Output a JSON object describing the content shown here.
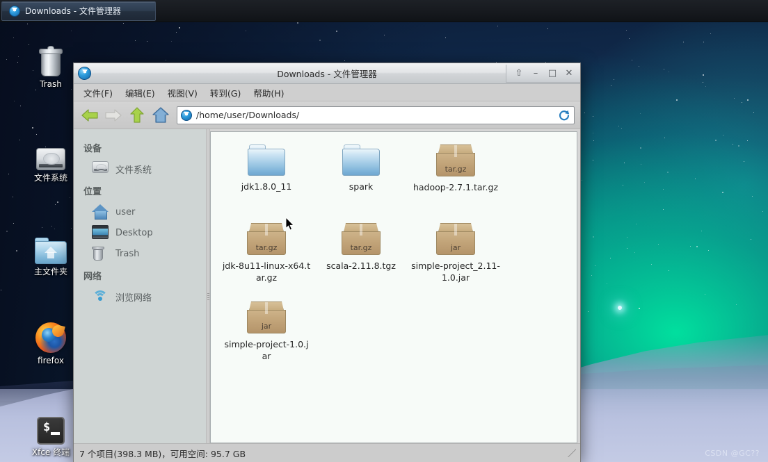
{
  "taskbar": {
    "buttons": [
      {
        "label": "Downloads - 文件管理器",
        "icon": "download-circle-icon"
      }
    ]
  },
  "desktop": {
    "icons": [
      {
        "label": "Trash",
        "icon": "trash-icon"
      },
      {
        "label": "文件系统",
        "icon": "hard-disk-icon"
      },
      {
        "label": "主文件夹",
        "icon": "home-folder-icon"
      },
      {
        "label": "firefox",
        "icon": "firefox-icon"
      },
      {
        "label": "Xfce 终端",
        "icon": "terminal-icon"
      }
    ],
    "watermark": "CSDN @GC??"
  },
  "window": {
    "title": "Downloads - 文件管理器",
    "icon": "download-circle-icon",
    "controls": [
      {
        "name": "shade",
        "glyph": "⇧"
      },
      {
        "name": "minimize",
        "glyph": "–"
      },
      {
        "name": "maximize",
        "glyph": "□"
      },
      {
        "name": "close",
        "glyph": "✕"
      }
    ],
    "menu": [
      {
        "label": "文件(F)"
      },
      {
        "label": "编辑(E)"
      },
      {
        "label": "视图(V)"
      },
      {
        "label": "转到(G)"
      },
      {
        "label": "帮助(H)"
      }
    ],
    "toolbar": {
      "back": "back-arrow",
      "forward": "forward-arrow",
      "up": "up-arrow",
      "home": "home-icon",
      "reload": "reload-icon",
      "path_value": "/home/user/Downloads/",
      "path_placeholder": "/home/user/Downloads/",
      "path_icon": "download-circle-icon"
    },
    "sidebar": {
      "groups": [
        {
          "title": "设备",
          "items": [
            {
              "label": "文件系统",
              "icon": "hard-disk-icon"
            }
          ]
        },
        {
          "title": "位置",
          "items": [
            {
              "label": "user",
              "icon": "home-icon"
            },
            {
              "label": "Desktop",
              "icon": "desktop-icon"
            },
            {
              "label": "Trash",
              "icon": "trash-icon"
            }
          ]
        },
        {
          "title": "网络",
          "items": [
            {
              "label": "浏览网络",
              "icon": "network-wifi-icon"
            }
          ]
        }
      ]
    },
    "files": [
      {
        "name": "jdk1.8.0_11",
        "type": "folder",
        "badge": ""
      },
      {
        "name": "spark",
        "type": "folder",
        "badge": ""
      },
      {
        "name": "hadoop-2.7.1.tar.gz",
        "type": "archive",
        "badge": "tar.gz"
      },
      {
        "name": "jdk-8u11-linux-x64.tar.gz",
        "type": "archive",
        "badge": "tar.gz"
      },
      {
        "name": "scala-2.11.8.tgz",
        "type": "archive",
        "badge": "tar.gz"
      },
      {
        "name": "simple-project_2.11-1.0.jar",
        "type": "archive",
        "badge": "jar"
      },
      {
        "name": "simple-project-1.0.jar",
        "type": "archive",
        "badge": "jar"
      }
    ],
    "statusbar": {
      "text": "7 个项目(398.3 MB)，可用空间: 95.7 GB"
    }
  },
  "colors": {
    "accent_blue": "#2f9ede",
    "window_chrome": "#d6d6d6",
    "sidebar_bg": "#cfd5d4",
    "fileview_bg": "#f7fbf8",
    "archive_tan": "#c2a479",
    "folder_blue": "#a5cde7"
  }
}
